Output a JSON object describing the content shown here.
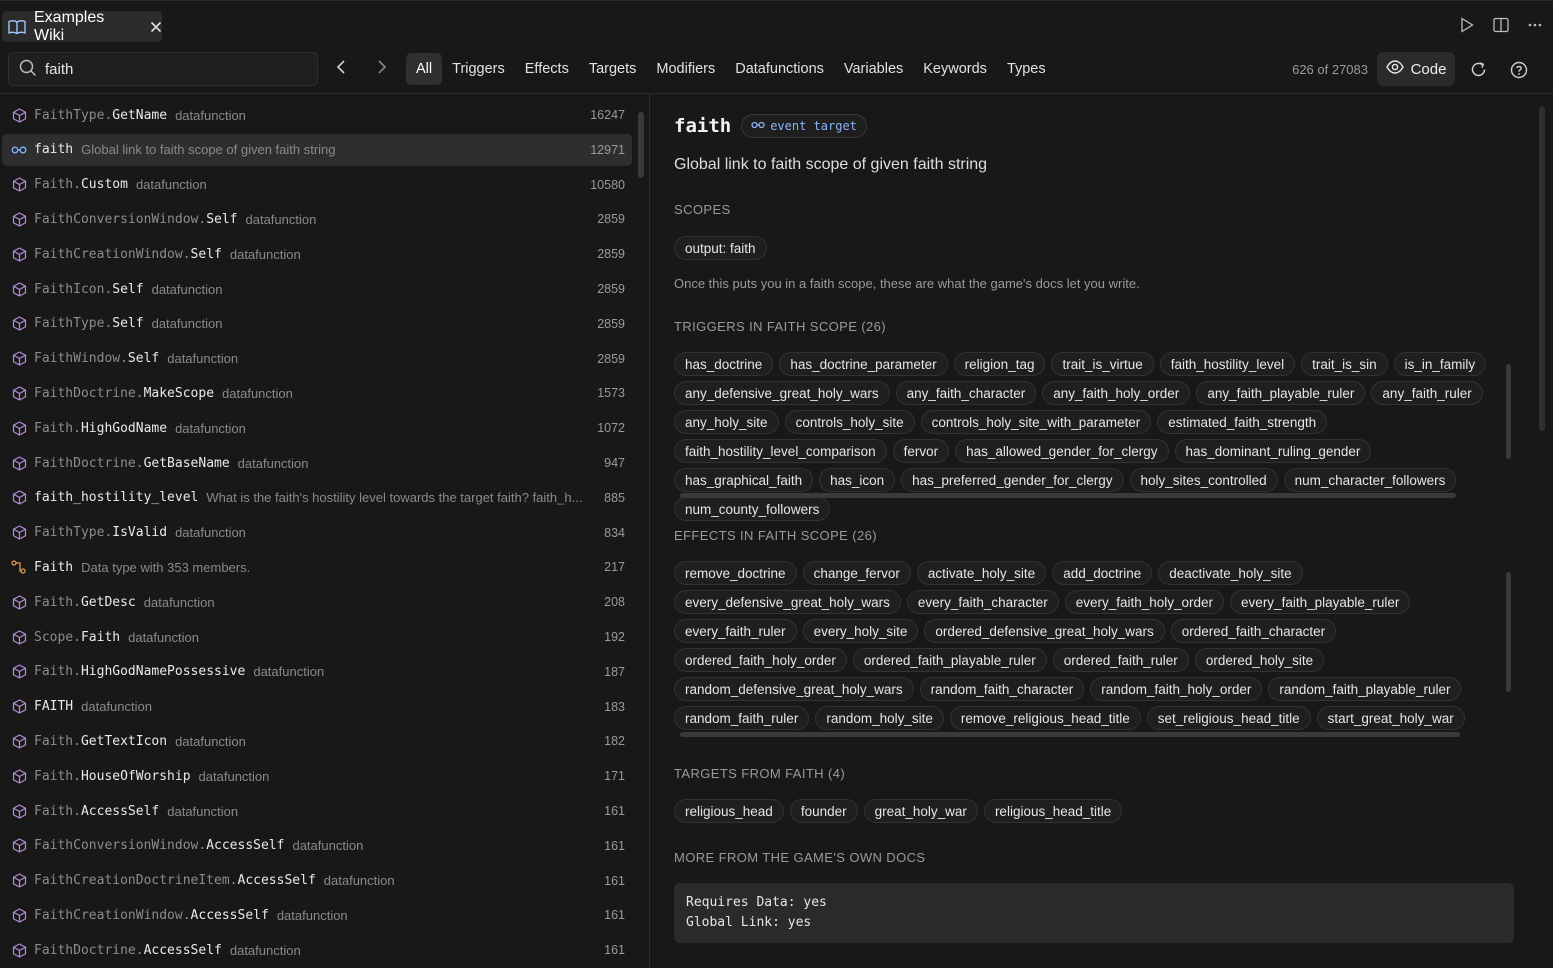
{
  "tab": {
    "title": "Examples Wiki"
  },
  "search": {
    "value": "faith",
    "placeholder": ""
  },
  "filters": [
    "All",
    "Triggers",
    "Effects",
    "Targets",
    "Modifiers",
    "Datafunctions",
    "Variables",
    "Keywords",
    "Types"
  ],
  "active_filter": "All",
  "count": "626 of 27083",
  "code_button": "Code",
  "list": [
    {
      "prefix": "FaithType.",
      "name": "GetName",
      "kind": "datafunction",
      "count": "16247",
      "icon": "cube-icon"
    },
    {
      "prefix": "",
      "name": "faith",
      "kind": "Global link to faith scope of given faith string",
      "count": "12971",
      "icon": "link-icon",
      "selected": true
    },
    {
      "prefix": "Faith.",
      "name": "Custom",
      "kind": "datafunction",
      "count": "10580",
      "icon": "cube-icon"
    },
    {
      "prefix": "FaithConversionWindow.",
      "name": "Self",
      "kind": "datafunction",
      "count": "2859",
      "icon": "cube-icon"
    },
    {
      "prefix": "FaithCreationWindow.",
      "name": "Self",
      "kind": "datafunction",
      "count": "2859",
      "icon": "cube-icon"
    },
    {
      "prefix": "FaithIcon.",
      "name": "Self",
      "kind": "datafunction",
      "count": "2859",
      "icon": "cube-icon"
    },
    {
      "prefix": "FaithType.",
      "name": "Self",
      "kind": "datafunction",
      "count": "2859",
      "icon": "cube-icon"
    },
    {
      "prefix": "FaithWindow.",
      "name": "Self",
      "kind": "datafunction",
      "count": "2859",
      "icon": "cube-icon"
    },
    {
      "prefix": "FaithDoctrine.",
      "name": "MakeScope",
      "kind": "datafunction",
      "count": "1573",
      "icon": "cube-icon"
    },
    {
      "prefix": "Faith.",
      "name": "HighGodName",
      "kind": "datafunction",
      "count": "1072",
      "icon": "cube-icon"
    },
    {
      "prefix": "FaithDoctrine.",
      "name": "GetBaseName",
      "kind": "datafunction",
      "count": "947",
      "icon": "cube-icon"
    },
    {
      "prefix": "",
      "name": "faith_hostility_level",
      "kind": "What is the faith's hostility level towards the target faith? faith_h...",
      "count": "885",
      "icon": "cube-icon",
      "bright": true
    },
    {
      "prefix": "FaithType.",
      "name": "IsValid",
      "kind": "datafunction",
      "count": "834",
      "icon": "cube-icon"
    },
    {
      "prefix": "",
      "name": "Faith",
      "kind": "Data type with 353 members.",
      "count": "217",
      "icon": "type-icon"
    },
    {
      "prefix": "Faith.",
      "name": "GetDesc",
      "kind": "datafunction",
      "count": "208",
      "icon": "cube-icon"
    },
    {
      "prefix": "Scope.",
      "name": "Faith",
      "kind": "datafunction",
      "count": "192",
      "icon": "cube-icon"
    },
    {
      "prefix": "Faith.",
      "name": "HighGodNamePossessive",
      "kind": "datafunction",
      "count": "187",
      "icon": "cube-icon"
    },
    {
      "prefix": "",
      "name": "FAITH",
      "kind": "datafunction",
      "count": "183",
      "icon": "cube-icon"
    },
    {
      "prefix": "Faith.",
      "name": "GetTextIcon",
      "kind": "datafunction",
      "count": "182",
      "icon": "cube-icon"
    },
    {
      "prefix": "Faith.",
      "name": "HouseOfWorship",
      "kind": "datafunction",
      "count": "171",
      "icon": "cube-icon"
    },
    {
      "prefix": "Faith.",
      "name": "AccessSelf",
      "kind": "datafunction",
      "count": "161",
      "icon": "cube-icon"
    },
    {
      "prefix": "FaithConversionWindow.",
      "name": "AccessSelf",
      "kind": "datafunction",
      "count": "161",
      "icon": "cube-icon"
    },
    {
      "prefix": "FaithCreationDoctrineItem.",
      "name": "AccessSelf",
      "kind": "datafunction",
      "count": "161",
      "icon": "cube-icon"
    },
    {
      "prefix": "FaithCreationWindow.",
      "name": "AccessSelf",
      "kind": "datafunction",
      "count": "161",
      "icon": "cube-icon"
    },
    {
      "prefix": "FaithDoctrine.",
      "name": "AccessSelf",
      "kind": "datafunction",
      "count": "161",
      "icon": "cube-icon"
    }
  ],
  "detail": {
    "title": "faith",
    "badge": "event target",
    "description": "Global link to faith scope of given faith string",
    "scopes_heading": "SCOPES",
    "scopes": [
      "output: faith"
    ],
    "scope_note": "Once this puts you in a faith scope, these are what the game's docs let you write.",
    "triggers_heading": "TRIGGERS IN FAITH SCOPE (26)",
    "triggers": [
      "has_doctrine",
      "has_doctrine_parameter",
      "religion_tag",
      "trait_is_virtue",
      "faith_hostility_level",
      "trait_is_sin",
      "is_in_family",
      "any_defensive_great_holy_wars",
      "any_faith_character",
      "any_faith_holy_order",
      "any_faith_playable_ruler",
      "any_faith_ruler",
      "any_holy_site",
      "controls_holy_site",
      "controls_holy_site_with_parameter",
      "estimated_faith_strength",
      "faith_hostility_level_comparison",
      "fervor",
      "has_allowed_gender_for_clergy",
      "has_dominant_ruling_gender",
      "has_graphical_faith",
      "has_icon",
      "has_preferred_gender_for_clergy",
      "holy_sites_controlled",
      "num_character_followers",
      "num_county_followers"
    ],
    "effects_heading": "EFFECTS IN FAITH SCOPE (26)",
    "effects": [
      "remove_doctrine",
      "change_fervor",
      "activate_holy_site",
      "add_doctrine",
      "deactivate_holy_site",
      "every_defensive_great_holy_wars",
      "every_faith_character",
      "every_faith_holy_order",
      "every_faith_playable_ruler",
      "every_faith_ruler",
      "every_holy_site",
      "ordered_defensive_great_holy_wars",
      "ordered_faith_character",
      "ordered_faith_holy_order",
      "ordered_faith_playable_ruler",
      "ordered_faith_ruler",
      "ordered_holy_site",
      "random_defensive_great_holy_wars",
      "random_faith_character",
      "random_faith_holy_order",
      "random_faith_playable_ruler",
      "random_faith_ruler",
      "random_holy_site",
      "remove_religious_head_title",
      "set_religious_head_title",
      "start_great_holy_war"
    ],
    "targets_heading": "TARGETS FROM FAITH (4)",
    "targets": [
      "religious_head",
      "founder",
      "great_holy_war",
      "religious_head_title"
    ],
    "docs_heading": "MORE FROM THE GAME'S OWN DOCS",
    "docs": [
      "Requires Data: yes",
      "Global Link: yes"
    ]
  }
}
